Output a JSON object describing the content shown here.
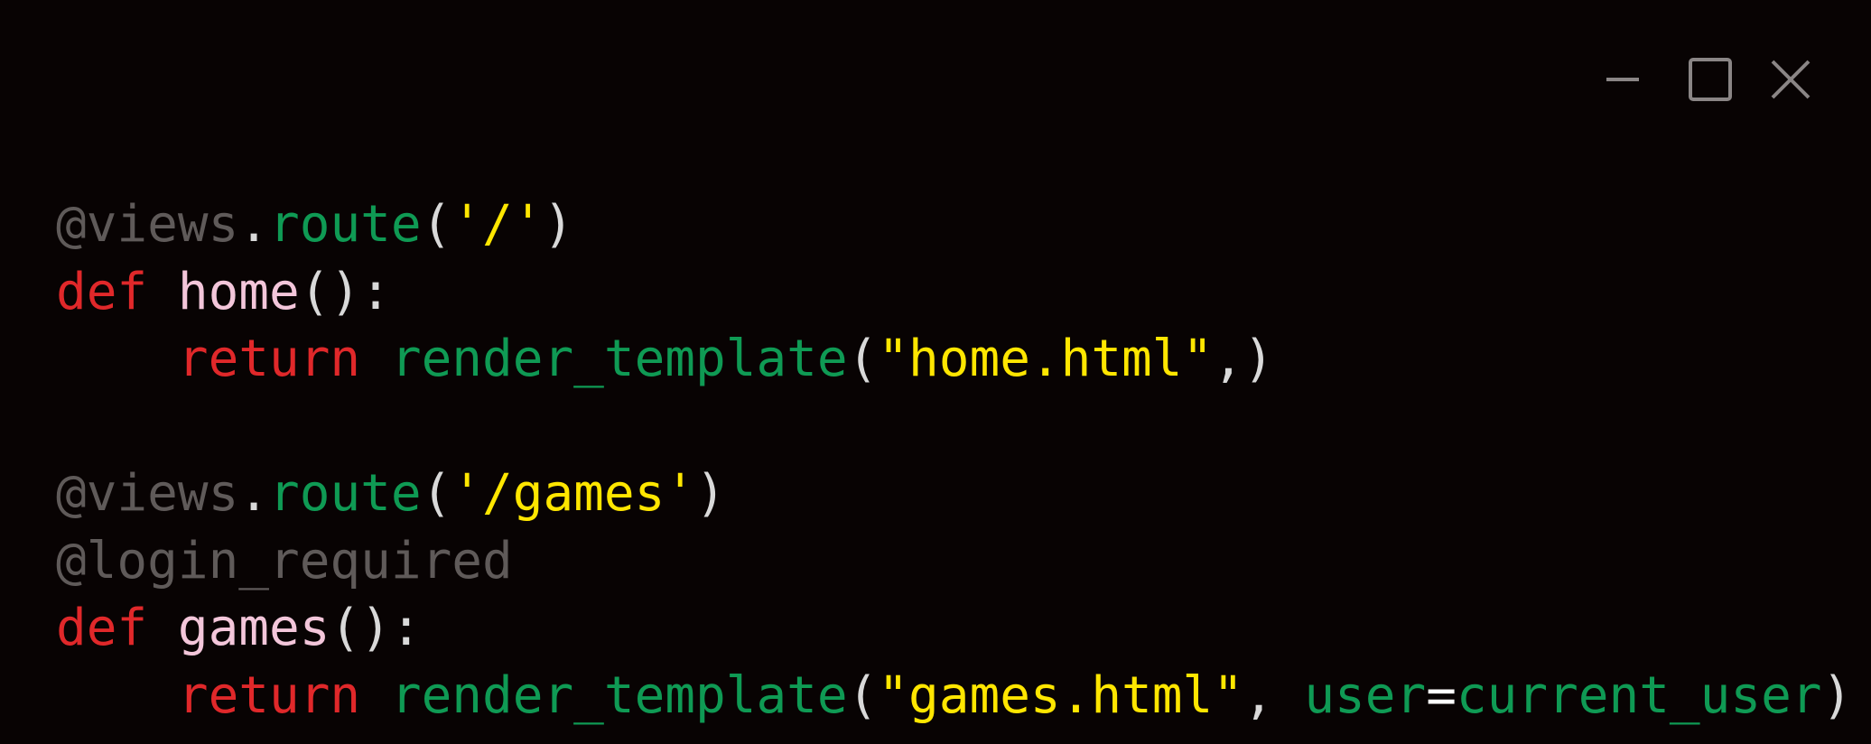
{
  "window": {
    "controls": {
      "minimize_icon": "minimize-icon",
      "maximize_icon": "maximize-icon",
      "close_icon": "close-icon"
    },
    "colors": {
      "background": "#080303",
      "decorator": "#5f5a59",
      "function": "#0f9a54",
      "string": "#ffe600",
      "keyword": "#e0282a",
      "def_name": "#f3c6da",
      "punctuation": "#d9d9d9",
      "control_icons": "#8a8585"
    }
  },
  "code": {
    "lines": [
      [
        {
          "text": "@views",
          "type": "decorator"
        },
        {
          "text": ".",
          "type": "punct"
        },
        {
          "text": "route",
          "type": "func"
        },
        {
          "text": "(",
          "type": "punct"
        },
        {
          "text": "'/'",
          "type": "string"
        },
        {
          "text": ")",
          "type": "punct"
        }
      ],
      [
        {
          "text": "def",
          "type": "keyword"
        },
        {
          "text": " ",
          "type": "punct"
        },
        {
          "text": "home",
          "type": "defname"
        },
        {
          "text": "():",
          "type": "punct"
        }
      ],
      [
        {
          "text": "    ",
          "type": "punct"
        },
        {
          "text": "return",
          "type": "keyword"
        },
        {
          "text": " ",
          "type": "punct"
        },
        {
          "text": "render_template",
          "type": "func"
        },
        {
          "text": "(",
          "type": "punct"
        },
        {
          "text": "\"home.html\"",
          "type": "string"
        },
        {
          "text": ",)",
          "type": "punct"
        }
      ],
      [],
      [
        {
          "text": "@views",
          "type": "decorator"
        },
        {
          "text": ".",
          "type": "punct"
        },
        {
          "text": "route",
          "type": "func"
        },
        {
          "text": "(",
          "type": "punct"
        },
        {
          "text": "'/games'",
          "type": "string"
        },
        {
          "text": ")",
          "type": "punct"
        }
      ],
      [
        {
          "text": "@login_required",
          "type": "decorator"
        }
      ],
      [
        {
          "text": "def",
          "type": "keyword"
        },
        {
          "text": " ",
          "type": "punct"
        },
        {
          "text": "games",
          "type": "defname"
        },
        {
          "text": "():",
          "type": "punct"
        }
      ],
      [
        {
          "text": "    ",
          "type": "punct"
        },
        {
          "text": "return",
          "type": "keyword"
        },
        {
          "text": " ",
          "type": "punct"
        },
        {
          "text": "render_template",
          "type": "func"
        },
        {
          "text": "(",
          "type": "punct"
        },
        {
          "text": "\"games.html\"",
          "type": "string"
        },
        {
          "text": ", ",
          "type": "punct"
        },
        {
          "text": "user",
          "type": "param"
        },
        {
          "text": "=",
          "type": "op"
        },
        {
          "text": "current_user",
          "type": "param"
        },
        {
          "text": ")",
          "type": "punct"
        }
      ]
    ]
  }
}
